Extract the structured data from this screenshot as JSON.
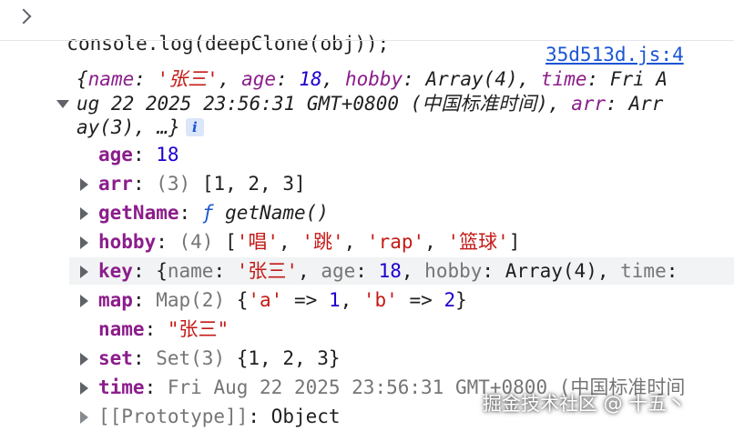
{
  "input": {
    "command": "console.log(deepClone(obj));"
  },
  "source_link": "35d513d.js:4",
  "summary": {
    "open": "{",
    "name_key": "name",
    "name_value": "'张三'",
    "age_key": "age",
    "age_value": "18",
    "hobby_key": "hobby",
    "hobby_value": "Array(4)",
    "time_key": "time",
    "time_value_part1": "Fri A",
    "time_value_part2": "ug 22 2025 23:56:31 GMT+0800 (中国标准时间)",
    "arr_key": "arr",
    "arr_value_part1": "Arr",
    "arr_value_part2": "ay(3)",
    "ellipsis": "…}",
    "info_badge": "i"
  },
  "properties": {
    "age": {
      "key": "age",
      "value": "18"
    },
    "arr": {
      "key": "arr",
      "count": "(3)",
      "value": "[1, 2, 3]"
    },
    "getName": {
      "key": "getName",
      "f": "ƒ",
      "value": "getName()"
    },
    "hobby": {
      "key": "hobby",
      "count": "(4)",
      "v1": "'唱'",
      "v2": "'跳'",
      "v3": "'rap'",
      "v4": "'篮球'"
    },
    "key": {
      "key": "key",
      "name_key": "name",
      "name_value": "'张三'",
      "age_key": "age",
      "age_value": "18",
      "hobby_key": "hobby",
      "hobby_value": "Array(4)",
      "time_key": "time"
    },
    "map": {
      "key": "map",
      "type": "Map(2)",
      "k1": "'a'",
      "v1": "1",
      "k2": "'b'",
      "v2": "2",
      "arrow": "=>"
    },
    "name": {
      "key": "name",
      "value": "\"张三\""
    },
    "set": {
      "key": "set",
      "type": "Set(3)",
      "value": "{1, 2, 3}"
    },
    "time": {
      "key": "time",
      "value": "Fri Aug 22 2025 23:56:31 GMT+0800 (中国标准时间"
    },
    "prototype": {
      "key": "[[Prototype]]",
      "value": "Object"
    }
  },
  "watermark": "掘金技术社区 @ 十五丶",
  "colors": {
    "key": "#8b1d8b",
    "string": "#c41a16",
    "number": "#1c00cf",
    "muted": "#757575",
    "link": "#1a55d4",
    "hover_bg": "#f1f3f4"
  }
}
